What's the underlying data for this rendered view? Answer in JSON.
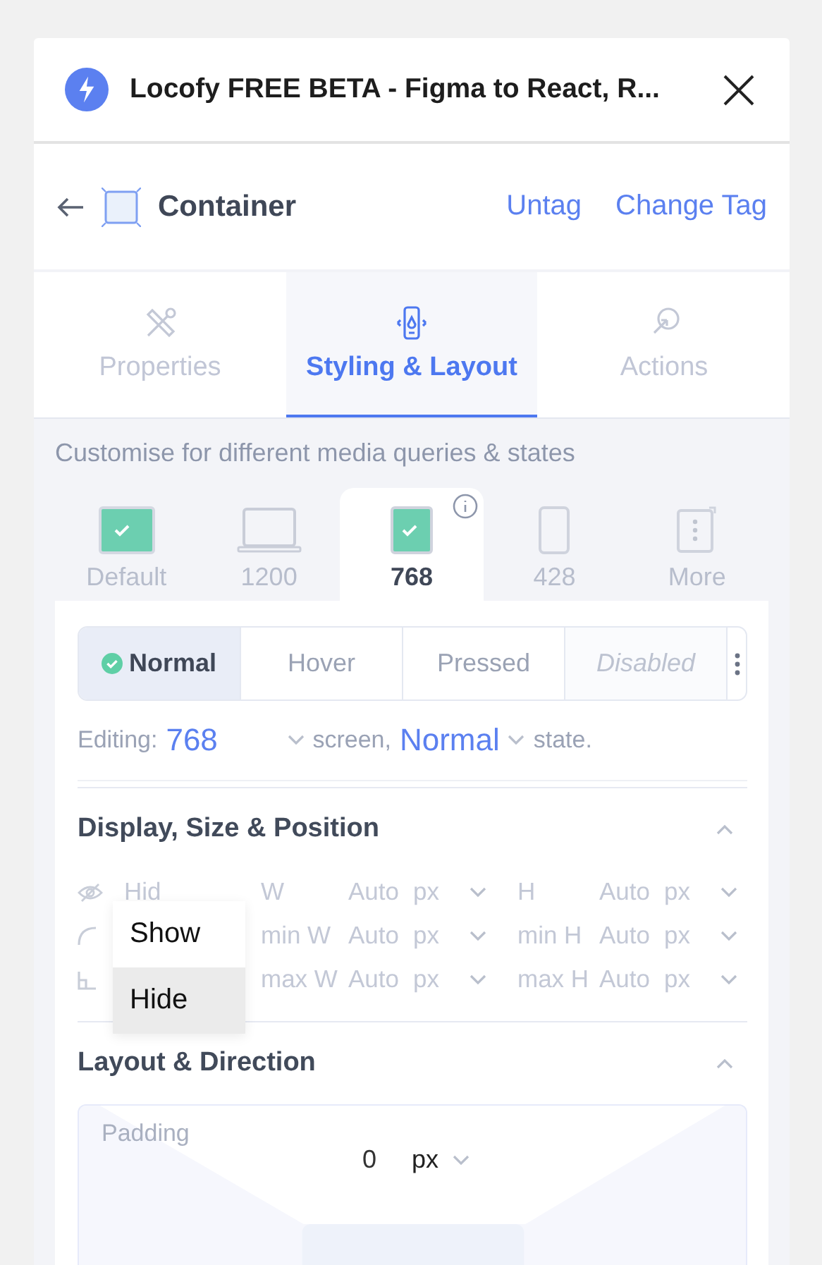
{
  "header": {
    "title": "Locofy FREE BETA - Figma to React, R..."
  },
  "tag_bar": {
    "name": "Container",
    "actions": [
      "Untag",
      "Change Tag"
    ]
  },
  "tabs": [
    {
      "label": "Properties",
      "kind": "tools",
      "selected": false
    },
    {
      "label": "Styling & Layout",
      "kind": "device",
      "selected": true
    },
    {
      "label": "Actions",
      "kind": "cursor",
      "selected": false
    }
  ],
  "description": "Customise for different media queries & states",
  "breakpoints": [
    {
      "label": "Default",
      "kind": "default",
      "checked": true,
      "selected": false
    },
    {
      "label": "1200",
      "kind": "laptop",
      "checked": false,
      "selected": false
    },
    {
      "label": "768",
      "kind": "tablet",
      "checked": true,
      "selected": true
    },
    {
      "label": "428",
      "kind": "phone",
      "checked": false,
      "selected": false
    },
    {
      "label": "More",
      "kind": "more",
      "checked": false,
      "selected": false
    }
  ],
  "states": [
    {
      "label": "Normal",
      "selected": true,
      "disabled": false
    },
    {
      "label": "Hover",
      "selected": false,
      "disabled": false
    },
    {
      "label": "Pressed",
      "selected": false,
      "disabled": false
    },
    {
      "label": "Disabled",
      "selected": false,
      "disabled": true
    }
  ],
  "editing": {
    "label": "Editing:",
    "screen": "768",
    "screen_suffix": "screen,",
    "state": "Normal",
    "state_suffix": "state."
  },
  "display_section": {
    "title": "Display, Size & Position",
    "expanded": true,
    "visibility": "Hid",
    "rows": [
      {
        "kind": "visibility",
        "w_label": "W",
        "w_value": "Auto",
        "w_unit": "px",
        "h_label": "H",
        "h_value": "Auto",
        "h_unit": "px"
      },
      {
        "kind": "radius",
        "w_label": "min W",
        "w_value": "Auto",
        "w_unit": "px",
        "h_label": "min H",
        "h_value": "Auto",
        "h_unit": "px"
      },
      {
        "kind": "corner",
        "w_label": "max W",
        "w_value": "Auto",
        "w_unit": "px",
        "h_label": "max H",
        "h_value": "Auto",
        "h_unit": "px"
      }
    ]
  },
  "visibility_menu": {
    "items": [
      {
        "label": "Show",
        "selected": false
      },
      {
        "label": "Hide",
        "selected": true
      }
    ]
  },
  "layout_section": {
    "title": "Layout & Direction",
    "expanded": true,
    "padding": {
      "label": "Padding",
      "top_value": "0",
      "top_unit": "px"
    }
  }
}
